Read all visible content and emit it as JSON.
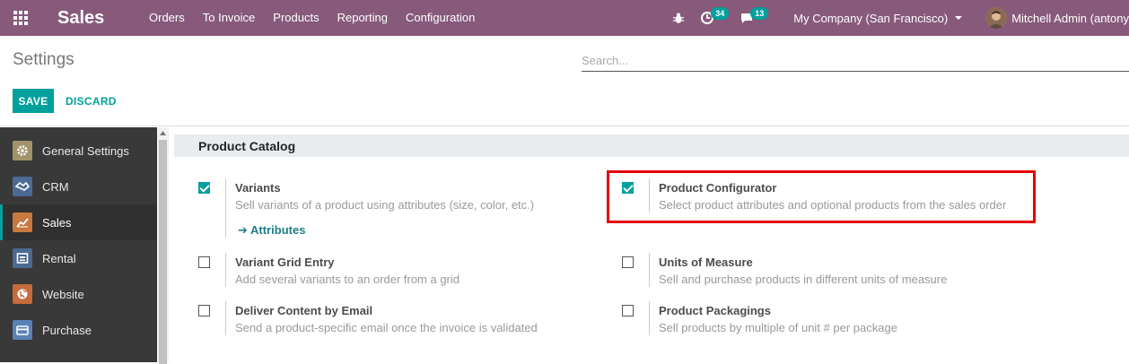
{
  "navbar": {
    "app_name": "Sales",
    "menu": [
      "Orders",
      "To Invoice",
      "Products",
      "Reporting",
      "Configuration"
    ],
    "activity_count": "34",
    "message_count": "13",
    "company": "My Company (San Francisco)",
    "user": "Mitchell Admin (antony"
  },
  "control_panel": {
    "breadcrumb": "Settings",
    "search_placeholder": "Search...",
    "save_label": "SAVE",
    "discard_label": "DISCARD"
  },
  "sidebar": {
    "items": [
      {
        "label": "General Settings",
        "icon": "gear-icon",
        "color": "#a3936b"
      },
      {
        "label": "CRM",
        "icon": "handshake-icon",
        "color": "#4c6b94"
      },
      {
        "label": "Sales",
        "icon": "chart-icon",
        "color": "#c8793f"
      },
      {
        "label": "Rental",
        "icon": "rental-icon",
        "color": "#4a6a8f"
      },
      {
        "label": "Website",
        "icon": "globe-icon",
        "color": "#c66b3d"
      },
      {
        "label": "Purchase",
        "icon": "card-icon",
        "color": "#5a82b5"
      }
    ]
  },
  "section": {
    "title": "Product Catalog"
  },
  "settings": {
    "variants": {
      "title": "Variants",
      "desc": "Sell variants of a product using attributes (size, color, etc.)",
      "checked": true,
      "link": "Attributes"
    },
    "configurator": {
      "title": "Product Configurator",
      "desc": "Select product attributes and optional products from the sales order",
      "checked": true
    },
    "grid_entry": {
      "title": "Variant Grid Entry",
      "desc": "Add several variants to an order from a grid",
      "checked": false
    },
    "uom": {
      "title": "Units of Measure",
      "desc": "Sell and purchase products in different units of measure",
      "checked": false
    },
    "deliver_email": {
      "title": "Deliver Content by Email",
      "desc": "Send a product-specific email once the invoice is validated",
      "checked": false
    },
    "packagings": {
      "title": "Product Packagings",
      "desc": "Sell products by multiple of unit # per package",
      "checked": false
    }
  },
  "colors": {
    "navbar": "#875a7b",
    "accent": "#00a09d",
    "highlight": "#e60000"
  }
}
